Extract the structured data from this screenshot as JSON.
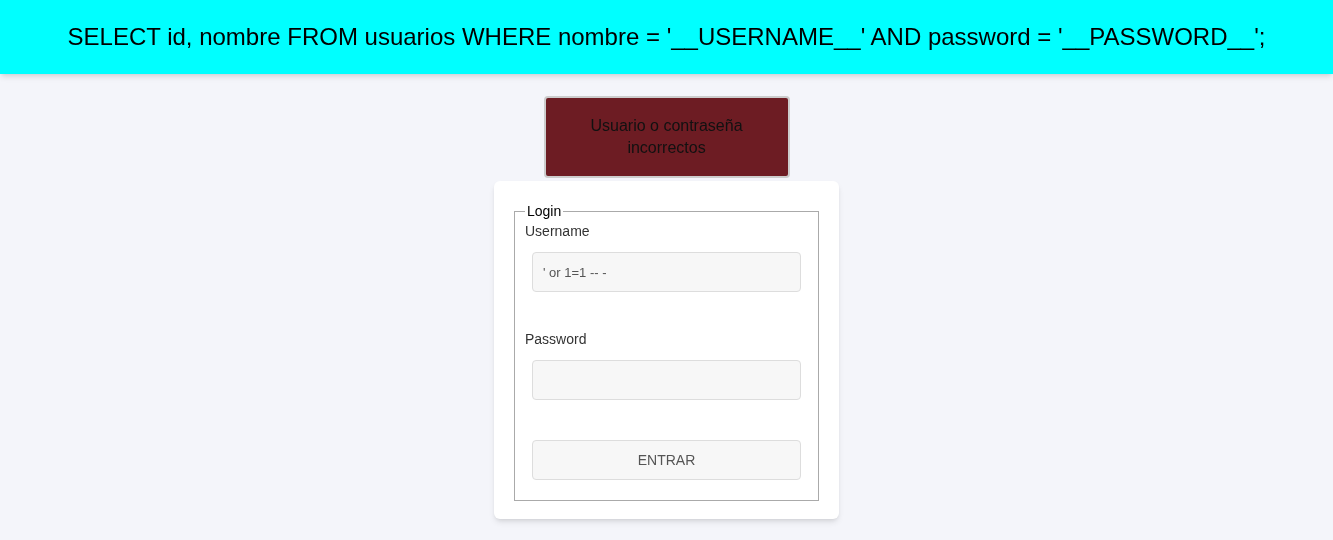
{
  "query_banner": {
    "text": "SELECT id, nombre FROM usuarios WHERE nombre = '__USERNAME__' AND password = '__PASSWORD__';"
  },
  "alert": {
    "text": "Usuario o contraseña incorrectos"
  },
  "login_form": {
    "legend": "Login",
    "fields": [
      {
        "label": "Username",
        "value": "' or 1=1 -- -"
      },
      {
        "label": "Password"
      }
    ],
    "submit": "ENTRAR"
  }
}
